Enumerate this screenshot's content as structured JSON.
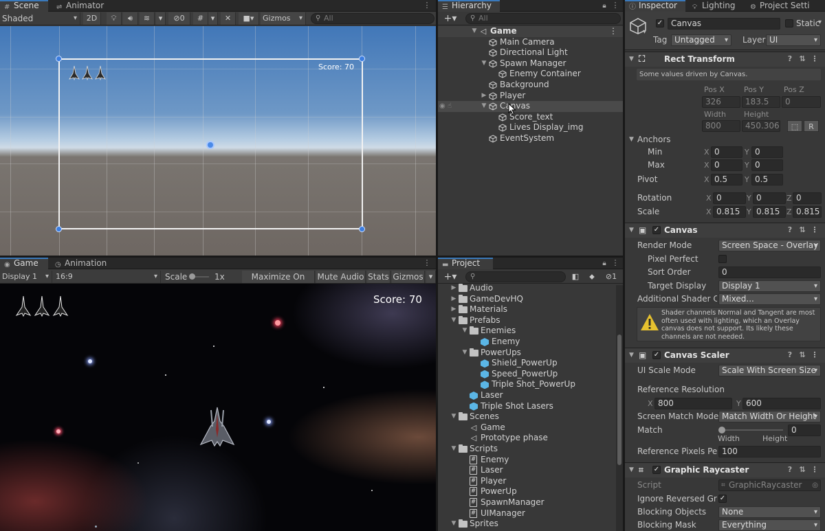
{
  "scene_panel": {
    "tabs": [
      {
        "label": "Scene",
        "active": true
      },
      {
        "label": "Animator",
        "active": false
      }
    ],
    "shading_mode": "Shaded",
    "mode_2d": "2D",
    "hidden_count": "0",
    "gizmos_label": "Gizmos",
    "search_placeholder": "All",
    "overlay_score": "Score: 70"
  },
  "game_panel": {
    "tabs": [
      {
        "label": "Game",
        "active": true
      },
      {
        "label": "Animation",
        "active": false
      }
    ],
    "display": "Display 1",
    "aspect": "16:9",
    "scale_label": "Scale",
    "scale_value": "1x",
    "scale_fraction": 0.0,
    "buttons": [
      "Maximize On Play",
      "Mute Audio",
      "Stats",
      "Gizmos"
    ],
    "score": "Score: 70"
  },
  "hierarchy": {
    "tab": "Hierarchy",
    "search_placeholder": "All",
    "items": [
      {
        "label": "Game",
        "depth": 0,
        "arrow": "▼",
        "icon": "unity-scene-icon",
        "bold": true
      },
      {
        "label": "Main Camera",
        "depth": 1,
        "arrow": "",
        "icon": "gameobject-icon"
      },
      {
        "label": "Directional Light",
        "depth": 1,
        "arrow": "",
        "icon": "gameobject-icon"
      },
      {
        "label": "Spawn Manager",
        "depth": 1,
        "arrow": "▼",
        "icon": "gameobject-icon"
      },
      {
        "label": "Enemy Container",
        "depth": 2,
        "arrow": "",
        "icon": "gameobject-icon"
      },
      {
        "label": "Background",
        "depth": 1,
        "arrow": "",
        "icon": "gameobject-icon"
      },
      {
        "label": "Player",
        "depth": 1,
        "arrow": "▶",
        "icon": "gameobject-icon"
      },
      {
        "label": "Canvas",
        "depth": 1,
        "arrow": "▼",
        "icon": "gameobject-icon",
        "selected": true
      },
      {
        "label": "Score_text",
        "depth": 2,
        "arrow": "",
        "icon": "gameobject-icon"
      },
      {
        "label": "Lives Display_img",
        "depth": 2,
        "arrow": "",
        "icon": "gameobject-icon"
      },
      {
        "label": "EventSystem",
        "depth": 1,
        "arrow": "",
        "icon": "gameobject-icon"
      }
    ]
  },
  "project": {
    "tab": "Project",
    "hidden_count": "1",
    "items": [
      {
        "label": "Audio",
        "depth": 0,
        "arrow": "▶",
        "icon": "folder-icon"
      },
      {
        "label": "GameDevHQ",
        "depth": 0,
        "arrow": "▶",
        "icon": "folder-icon"
      },
      {
        "label": "Materials",
        "depth": 0,
        "arrow": "▶",
        "icon": "folder-icon"
      },
      {
        "label": "Prefabs",
        "depth": 0,
        "arrow": "▼",
        "icon": "folder-icon"
      },
      {
        "label": "Enemies",
        "depth": 1,
        "arrow": "▼",
        "icon": "folder-icon"
      },
      {
        "label": "Enemy",
        "depth": 2,
        "arrow": "",
        "icon": "prefab-icon"
      },
      {
        "label": "PowerUps",
        "depth": 1,
        "arrow": "▼",
        "icon": "folder-icon"
      },
      {
        "label": "Shield_PowerUp",
        "depth": 2,
        "arrow": "",
        "icon": "prefab-icon"
      },
      {
        "label": "Speed_PowerUp",
        "depth": 2,
        "arrow": "",
        "icon": "prefab-icon"
      },
      {
        "label": "Triple Shot_PowerUp",
        "depth": 2,
        "arrow": "",
        "icon": "prefab-icon"
      },
      {
        "label": "Laser",
        "depth": 1,
        "arrow": "",
        "icon": "prefab-icon"
      },
      {
        "label": "Triple Shot Lasers",
        "depth": 1,
        "arrow": "",
        "icon": "prefab-icon"
      },
      {
        "label": "Scenes",
        "depth": 0,
        "arrow": "▼",
        "icon": "folder-icon"
      },
      {
        "label": "Game",
        "depth": 1,
        "arrow": "",
        "icon": "unity-scene-icon"
      },
      {
        "label": "Prototype phase",
        "depth": 1,
        "arrow": "",
        "icon": "unity-scene-icon"
      },
      {
        "label": "Scripts",
        "depth": 0,
        "arrow": "▼",
        "icon": "folder-icon"
      },
      {
        "label": "Enemy",
        "depth": 1,
        "arrow": "",
        "icon": "script-icon"
      },
      {
        "label": "Laser",
        "depth": 1,
        "arrow": "",
        "icon": "script-icon"
      },
      {
        "label": "Player",
        "depth": 1,
        "arrow": "",
        "icon": "script-icon"
      },
      {
        "label": "PowerUp",
        "depth": 1,
        "arrow": "",
        "icon": "script-icon"
      },
      {
        "label": "SpawnManager",
        "depth": 1,
        "arrow": "",
        "icon": "script-icon"
      },
      {
        "label": "UIManager",
        "depth": 1,
        "arrow": "",
        "icon": "script-icon"
      },
      {
        "label": "Sprites",
        "depth": 0,
        "arrow": "▼",
        "icon": "folder-icon"
      }
    ]
  },
  "inspector": {
    "tabs": [
      {
        "label": "Inspector",
        "active": true
      },
      {
        "label": "Lighting",
        "active": false
      },
      {
        "label": "Project Setti",
        "active": false
      }
    ],
    "object_name": "Canvas",
    "static_label": "Static",
    "tag_label": "Tag",
    "tag_value": "Untagged",
    "layer_label": "Layer",
    "layer_value": "UI",
    "rect_transform": {
      "title": "Rect Transform",
      "note": "Some values driven by Canvas.",
      "pos_x_label": "Pos X",
      "pos_y_label": "Pos Y",
      "pos_z_label": "Pos Z",
      "pos_x": "326",
      "pos_y": "183.5",
      "pos_z": "0",
      "width_label": "Width",
      "height_label": "Height",
      "width": "800",
      "height": "450.3068",
      "r_button": "R",
      "anchors_label": "Anchors",
      "min_label": "Min",
      "min_x": "0",
      "min_y": "0",
      "max_label": "Max",
      "max_x": "0",
      "max_y": "0",
      "pivot_label": "Pivot",
      "pivot_x": "0.5",
      "pivot_y": "0.5",
      "rotation_label": "Rotation",
      "rot_x": "0",
      "rot_y": "0",
      "rot_z": "0",
      "scale_label": "Scale",
      "scale_x": "0.815",
      "scale_y": "0.815",
      "scale_z": "0.815"
    },
    "canvas": {
      "title": "Canvas",
      "render_mode_label": "Render Mode",
      "render_mode": "Screen Space - Overlay",
      "pixel_perfect_label": "Pixel Perfect",
      "sort_order_label": "Sort Order",
      "sort_order": "0",
      "target_display_label": "Target Display",
      "target_display": "Display 1",
      "shader_label": "Additional Shader Ch",
      "shader_value": "Mixed...",
      "warning": "Shader channels Normal and Tangent are most often used with lighting, which an Overlay canvas does not support. Its likely these channels are not needed."
    },
    "canvas_scaler": {
      "title": "Canvas Scaler",
      "ui_scale_mode_label": "UI Scale Mode",
      "ui_scale_mode": "Scale With Screen Size",
      "ref_res_label": "Reference Resolution",
      "ref_x": "800",
      "ref_y": "600",
      "match_mode_label": "Screen Match Mode",
      "match_mode": "Match Width Or Height",
      "match_label": "Match",
      "match_value": "0",
      "match_fraction": 0.0,
      "width_label": "Width",
      "height_label": "Height",
      "ref_ppu_label": "Reference Pixels Per",
      "ref_ppu": "100"
    },
    "graphic_raycaster": {
      "title": "Graphic Raycaster",
      "script_label": "Script",
      "script_value": "GraphicRaycaster",
      "ignore_label": "Ignore Reversed Grap",
      "blocking_objects_label": "Blocking Objects",
      "blocking_objects": "None",
      "blocking_mask_label": "Blocking Mask",
      "blocking_mask": "Everything"
    }
  },
  "colors": {
    "accent": "#3a79bb",
    "selection": "#4d4d4d",
    "warning": "#e6c12f",
    "prefab": "#5bb6e6"
  }
}
